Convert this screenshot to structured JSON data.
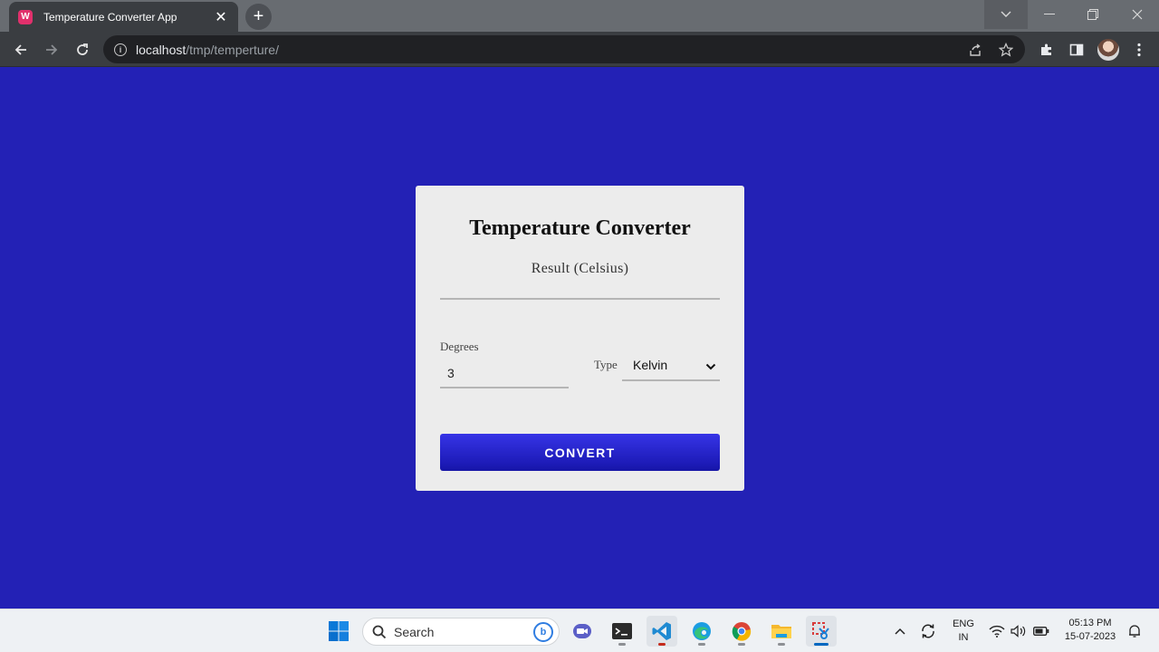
{
  "browser": {
    "tab_title": "Temperature Converter App",
    "tab_favicon": "W",
    "url_host": "localhost",
    "url_path": "/tmp/temperture/"
  },
  "app": {
    "title": "Temperature Converter",
    "result_label": "Result (Celsius)",
    "degrees_label": "Degrees",
    "degrees_value": "3",
    "type_label": "Type",
    "type_selected": "Kelvin",
    "convert_label": "CONVERT"
  },
  "taskbar": {
    "search_placeholder": "Search",
    "lang_line1": "ENG",
    "lang_line2": "IN",
    "time": "05:13 PM",
    "date": "15-07-2023"
  },
  "colors": {
    "page_background": "#2321b5",
    "card_background": "#ececec",
    "button_background": "#2321d0"
  }
}
